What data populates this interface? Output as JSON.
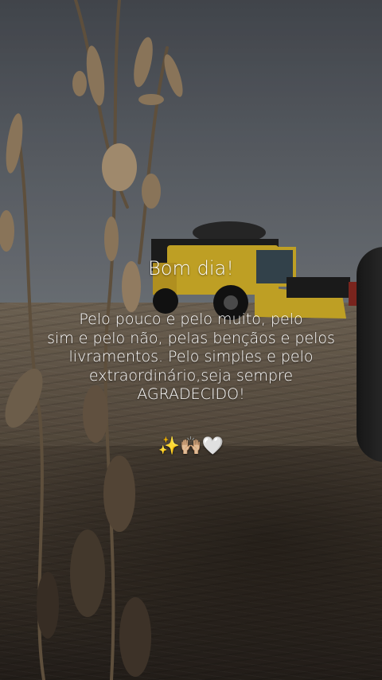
{
  "post": {
    "title": "Bom dia!",
    "message": "Pelo pouco e pelo muito, pelo\nsim e pelo não, pelas bençãos e pelos\nlivramentos. Pelo simples e pelo\nextraordinário,seja sempre\nAGRADECIDO!",
    "emojis": "✨🙌🏼🤍"
  },
  "colors": {
    "harvester_yellow": "#d9b52a",
    "text": "#ffffff"
  }
}
